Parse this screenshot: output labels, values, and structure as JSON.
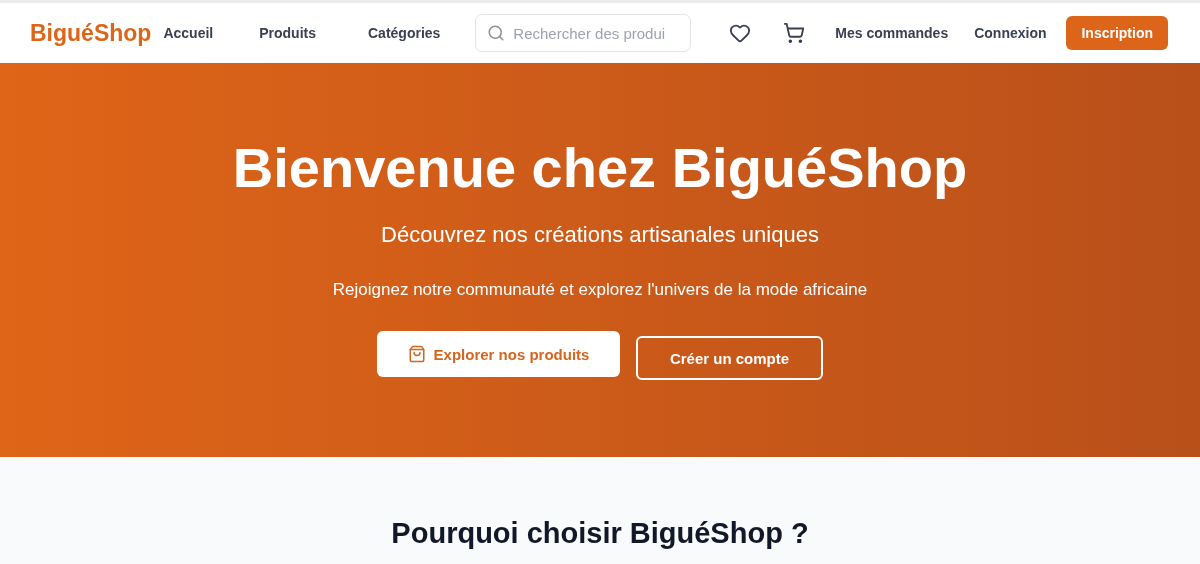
{
  "header": {
    "logo": "BiguéShop",
    "nav": [
      {
        "label": "Accueil"
      },
      {
        "label": "Produits"
      },
      {
        "label": "Catégories"
      }
    ],
    "search": {
      "placeholder": "Rechercher des produi"
    },
    "links": [
      {
        "label": "Mes commandes"
      },
      {
        "label": "Connexion"
      }
    ],
    "signup": "Inscription"
  },
  "hero": {
    "title": "Bienvenue chez BiguéShop",
    "subtitle": "Découvrez nos créations artisanales uniques",
    "tagline": "Rejoignez notre communauté et explorez l'univers de la mode africaine",
    "primary": "Explorer nos produits",
    "secondary": "Créer un compte"
  },
  "features": {
    "title": "Pourquoi choisir BiguéShop ?"
  }
}
